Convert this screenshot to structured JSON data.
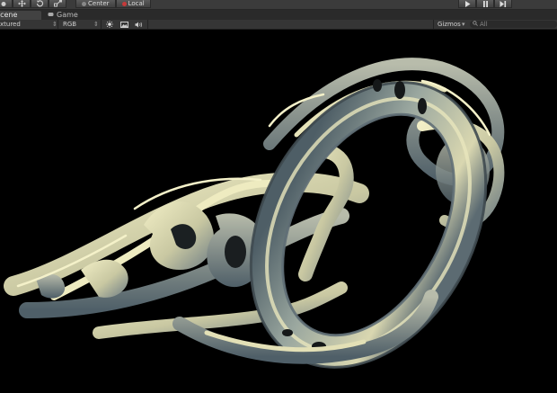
{
  "toolbar": {
    "pivot_label": "Center",
    "space_label": "Local",
    "pivot_color": "#888888",
    "space_color": "#c43a3a"
  },
  "tabs": [
    {
      "label": "Scene",
      "active": true,
      "icon": "scene-grid-icon"
    },
    {
      "label": "Game",
      "active": false,
      "icon": "game-controller-icon"
    }
  ],
  "scene_bar": {
    "render_mode": "xtured",
    "render_mode_arrow": "⇕",
    "color_mode": "RGB",
    "color_mode_arrow": "⇕",
    "gizmos_label": "Gizmos",
    "gizmos_arrow": "▾",
    "search_placeholder": "All"
  },
  "colors": {
    "toolbar_bg": "#3b3b3b",
    "viewport_bg": "#000000",
    "model_light": "#e8e6bc",
    "model_shadow": "#5a6a72"
  },
  "icons": {
    "tools": [
      "hand-icon",
      "move-icon",
      "rotate-icon",
      "scale-icon"
    ],
    "scene_toggles": [
      "sun-lighting-icon",
      "image-effects-icon",
      "audio-speaker-icon"
    ],
    "playback": [
      "play-icon",
      "pause-icon",
      "step-icon"
    ]
  }
}
